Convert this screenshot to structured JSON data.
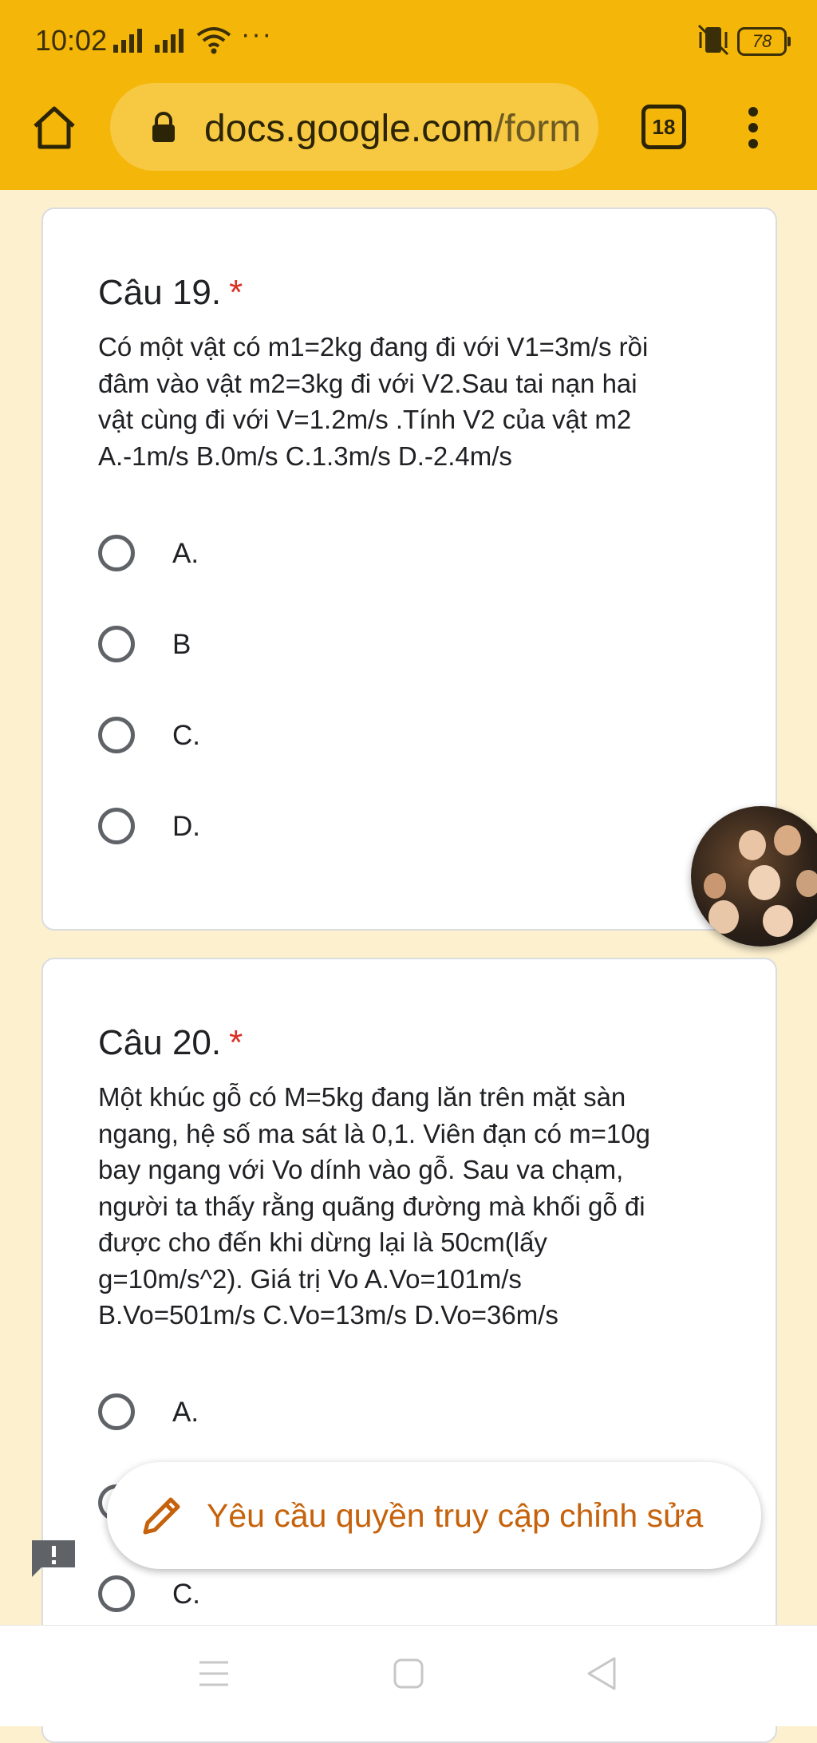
{
  "status_bar": {
    "time": "10:02",
    "more_indicator": "···",
    "battery": "78"
  },
  "browser": {
    "url_host": "docs.google.com",
    "url_path": "/form",
    "tab_count": "18",
    "icons": [
      "home-icon",
      "lock-icon",
      "tab-switcher-icon",
      "overflow-menu-icon"
    ]
  },
  "questions": [
    {
      "title": "Câu 19.",
      "required_mark": "*",
      "text": "Có một vật có m1=2kg đang đi với V1=3m/s rồi\nđâm vào vật m2=3kg đi với V2.Sau tai nạn hai\nvật cùng đi với V=1.2m/s .Tính V2 của vật m2\nA.-1m/s B.0m/s C.1.3m/s D.-2.4m/s",
      "options": [
        "A.",
        "B",
        "C.",
        "D."
      ]
    },
    {
      "title": "Câu 20.",
      "required_mark": "*",
      "text": "Một khúc gỗ có M=5kg đang lăn trên mặt sàn\nngang, hệ số ma sát là 0,1. Viên đạn có m=10g\nbay ngang với Vo dính vào gỗ. Sau va chạm,\nngười ta thấy rằng quãng đường mà khối gỗ đi\nđược cho đến khi dừng lại là 50cm(lấy\ng=10m/s^2). Giá trị Vo A.Vo=101m/s\nB.Vo=501m/s C.Vo=13m/s D.Vo=36m/s",
      "options": [
        "A.",
        "C."
      ]
    }
  ],
  "edit_request_button": {
    "label": "Yêu cầu quyền truy cập chỉnh sửa",
    "icon": "pencil-icon",
    "color": "#c5620b"
  },
  "colors": {
    "toolbar": "#f4b608",
    "page_background": "#fdf0cf",
    "required": "#d93025"
  }
}
